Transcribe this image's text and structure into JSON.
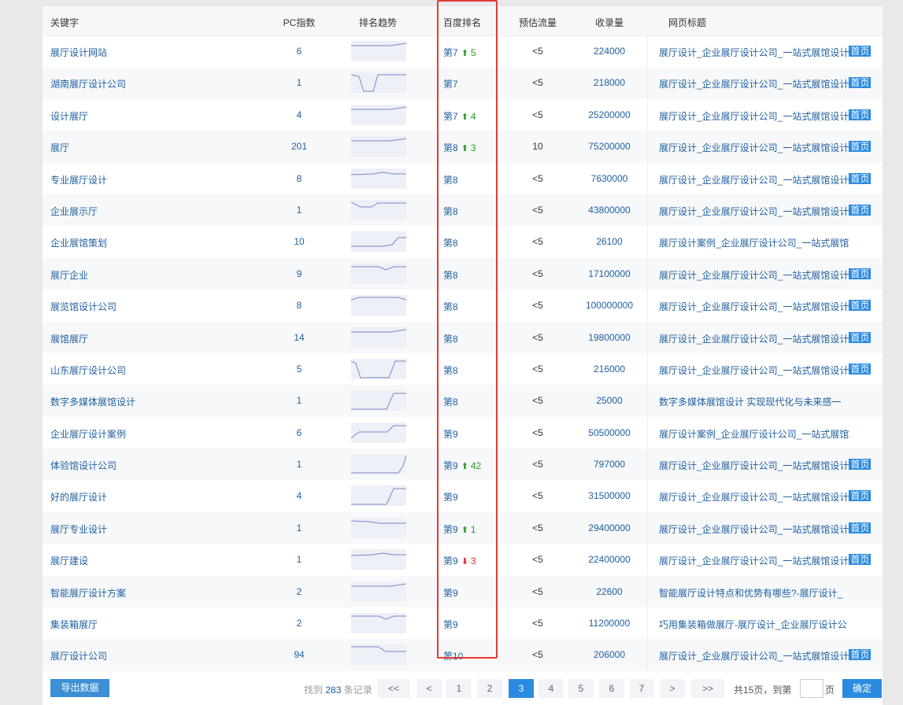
{
  "headers": {
    "keyword": "关键字",
    "pc_index": "PC指数",
    "trend": "排名趋势",
    "baidu_rank": "百度排名",
    "traffic": "预估流量",
    "indexed": "收录量",
    "page_title": "网页标题"
  },
  "rows": [
    {
      "keyword": "展厅设计网站",
      "pc": "6",
      "rank": "第7",
      "change": "5",
      "dir": "up",
      "traffic": "<5",
      "indexed": "224000",
      "title": "展厅设计_企业展厅设计公司_一站式展馆设计",
      "badge": "首页",
      "trend": "flat"
    },
    {
      "keyword": "湖南展厅设计公司",
      "pc": "1",
      "rank": "第7",
      "change": "",
      "dir": "",
      "traffic": "<5",
      "indexed": "218000",
      "title": "展厅设计_企业展厅设计公司_一站式展馆设计",
      "badge": "首页",
      "trend": "dip"
    },
    {
      "keyword": "设计展厅",
      "pc": "4",
      "rank": "第7",
      "change": "4",
      "dir": "up",
      "traffic": "<5",
      "indexed": "25200000",
      "title": "展厅设计_企业展厅设计公司_一站式展馆设计",
      "badge": "首页",
      "trend": "flat"
    },
    {
      "keyword": "展厅",
      "pc": "201",
      "rank": "第8",
      "change": "3",
      "dir": "up",
      "traffic": "10",
      "indexed": "75200000",
      "title": "展厅设计_企业展厅设计公司_一站式展馆设计",
      "badge": "首页",
      "trend": "flat"
    },
    {
      "keyword": "专业展厅设计",
      "pc": "8",
      "rank": "第8",
      "change": "",
      "dir": "",
      "traffic": "<5",
      "indexed": "7630000",
      "title": "展厅设计_企业展厅设计公司_一站式展馆设计",
      "badge": "首页",
      "trend": "bump"
    },
    {
      "keyword": "企业展示厅",
      "pc": "1",
      "rank": "第8",
      "change": "",
      "dir": "",
      "traffic": "<5",
      "indexed": "43800000",
      "title": "展厅设计_企业展厅设计公司_一站式展馆设计",
      "badge": "首页",
      "trend": "smalldip"
    },
    {
      "keyword": "企业展馆策划",
      "pc": "10",
      "rank": "第8",
      "change": "",
      "dir": "",
      "traffic": "<5",
      "indexed": "26100",
      "title": "展厅设计案例_企业展厅设计公司_一站式展馆",
      "badge": "",
      "trend": "rise"
    },
    {
      "keyword": "展厅企业",
      "pc": "9",
      "rank": "第8",
      "change": "",
      "dir": "",
      "traffic": "<5",
      "indexed": "17100000",
      "title": "展厅设计_企业展厅设计公司_一站式展馆设计",
      "badge": "首页",
      "trend": "wiggle"
    },
    {
      "keyword": "展览馆设计公司",
      "pc": "8",
      "rank": "第8",
      "change": "",
      "dir": "",
      "traffic": "<5",
      "indexed": "100000000",
      "title": "展厅设计_企业展厅设计公司_一站式展馆设计",
      "badge": "首页",
      "trend": "hump"
    },
    {
      "keyword": "展馆展厅",
      "pc": "14",
      "rank": "第8",
      "change": "",
      "dir": "",
      "traffic": "<5",
      "indexed": "19800000",
      "title": "展厅设计_企业展厅设计公司_一站式展馆设计",
      "badge": "首页",
      "trend": "flat"
    },
    {
      "keyword": "山东展厅设计公司",
      "pc": "5",
      "rank": "第8",
      "change": "",
      "dir": "",
      "traffic": "<5",
      "indexed": "216000",
      "title": "展厅设计_企业展厅设计公司_一站式展馆设计",
      "badge": "首页",
      "trend": "deepdip"
    },
    {
      "keyword": "数字多媒体展馆设计",
      "pc": "1",
      "rank": "第8",
      "change": "",
      "dir": "",
      "traffic": "<5",
      "indexed": "25000",
      "title": "数字多媒体展馆设计 实现现代化与未来感一",
      "badge": "",
      "trend": "lateup"
    },
    {
      "keyword": "企业展厅设计案例",
      "pc": "6",
      "rank": "第9",
      "change": "",
      "dir": "",
      "traffic": "<5",
      "indexed": "50500000",
      "title": "展厅设计案例_企业展厅设计公司_一站式展馆",
      "badge": "",
      "trend": "steps"
    },
    {
      "keyword": "体验馆设计公司",
      "pc": "1",
      "rank": "第9",
      "change": "42",
      "dir": "up",
      "traffic": "<5",
      "indexed": "797000",
      "title": "展厅设计_企业展厅设计公司_一站式展馆设计",
      "badge": "首页",
      "trend": "spike"
    },
    {
      "keyword": "好的展厅设计",
      "pc": "4",
      "rank": "第9",
      "change": "",
      "dir": "",
      "traffic": "<5",
      "indexed": "31500000",
      "title": "展厅设计_企业展厅设计公司_一站式展馆设计",
      "badge": "首页",
      "trend": "lateup"
    },
    {
      "keyword": "展厅专业设计",
      "pc": "1",
      "rank": "第9",
      "change": "1",
      "dir": "up",
      "traffic": "<5",
      "indexed": "29400000",
      "title": "展厅设计_企业展厅设计公司_一站式展馆设计",
      "badge": "首页",
      "trend": "slightfall"
    },
    {
      "keyword": "展厅建设",
      "pc": "1",
      "rank": "第9",
      "change": "3",
      "dir": "down",
      "traffic": "<5",
      "indexed": "22400000",
      "title": "展厅设计_企业展厅设计公司_一站式展馆设计",
      "badge": "首页",
      "trend": "bump"
    },
    {
      "keyword": "智能展厅设计方案",
      "pc": "2",
      "rank": "第9",
      "change": "",
      "dir": "",
      "traffic": "<5",
      "indexed": "22600",
      "title": "智能展厅设计特点和优势有哪些?-展厅设计_",
      "badge": "",
      "trend": "flat"
    },
    {
      "keyword": "集装箱展厅",
      "pc": "2",
      "rank": "第9",
      "change": "",
      "dir": "",
      "traffic": "<5",
      "indexed": "11200000",
      "title": "巧用集装箱做展厅-展厅设计_企业展厅设计公",
      "badge": "",
      "trend": "wiggle"
    },
    {
      "keyword": "展厅设计公司",
      "pc": "94",
      "rank": "第10",
      "change": "",
      "dir": "",
      "traffic": "<5",
      "indexed": "206000",
      "title": "展厅设计_企业展厅设计公司_一站式展馆设计",
      "badge": "首页",
      "trend": "fall"
    }
  ],
  "footer": {
    "export_label": "导出数据",
    "found_prefix": "找到",
    "found_count": "283",
    "found_suffix": "条记录",
    "pages": [
      "<<",
      "<",
      "1",
      "2",
      "3",
      "4",
      "5",
      "6",
      "7",
      ">",
      ">>"
    ],
    "active_page": "3",
    "total_text": "共15页，到第",
    "page_unit": "页",
    "confirm_label": "确定"
  },
  "colors": {
    "link": "#1f5f9e",
    "up": "#2e9a2e",
    "down": "#d9302c",
    "highlight": "#e53935",
    "accent": "#2b8be0"
  }
}
